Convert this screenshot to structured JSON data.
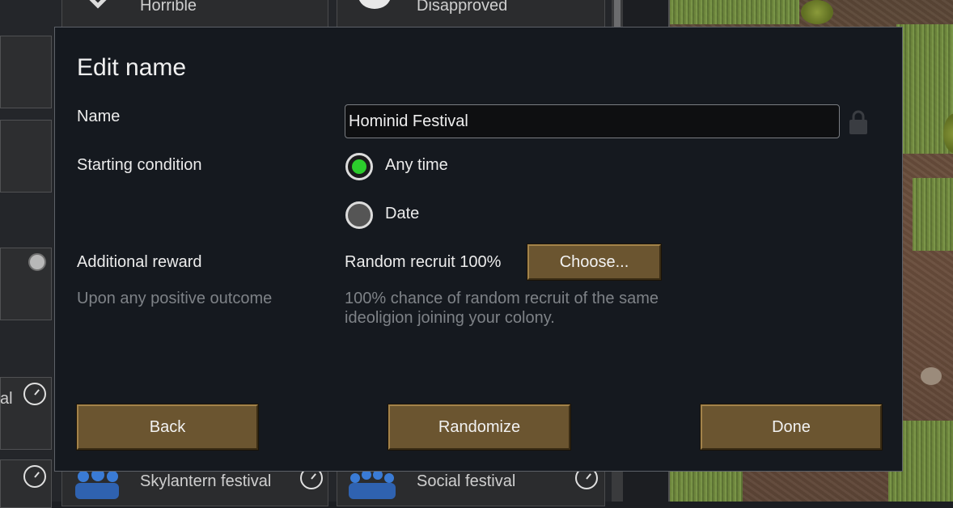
{
  "background": {
    "top_tiles": [
      {
        "label": "Horrible",
        "icon": "broken-heart-icon"
      },
      {
        "label": "Disapproved",
        "icon": "skull-icon"
      }
    ],
    "bottom_tiles": [
      {
        "label": "Skylantern festival",
        "icon": "people-icon"
      },
      {
        "label": "Social festival",
        "icon": "people-icon"
      }
    ],
    "side_fragment": "al"
  },
  "dialog": {
    "title": "Edit name",
    "name_label": "Name",
    "name_value": "Hominid Festival",
    "starting_condition_label": "Starting condition",
    "options": [
      {
        "label": "Any time",
        "selected": true
      },
      {
        "label": "Date",
        "selected": false
      }
    ],
    "additional_reward_label": "Additional reward",
    "reward_subtitle": "Upon any positive outcome",
    "reward_value": "Random recruit 100%",
    "choose_button": "Choose...",
    "reward_description_line1": "100% chance of random recruit of the same",
    "reward_description_line2": "ideoligion joining your colony.",
    "back_button": "Back",
    "randomize_button": "Randomize",
    "done_button": "Done"
  },
  "colors": {
    "dialog_bg": "#15191f",
    "button_wood": "#6b5530",
    "radio_selected": "#2ccd2c",
    "muted_text": "#7e8287"
  }
}
